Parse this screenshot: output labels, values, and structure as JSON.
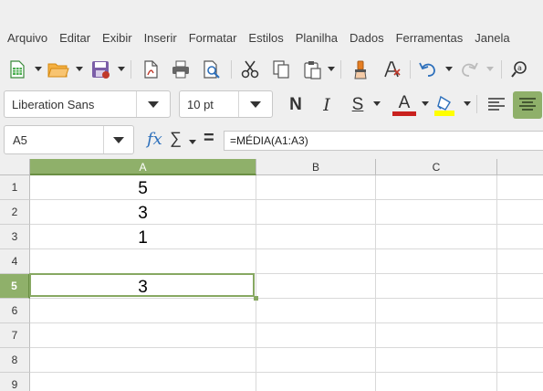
{
  "menubar": {
    "items": [
      "Arquivo",
      "Editar",
      "Exibir",
      "Inserir",
      "Formatar",
      "Estilos",
      "Planilha",
      "Dados",
      "Ferramentas",
      "Janela"
    ]
  },
  "toolbar_icons": [
    "new-spreadsheet-icon",
    "open-icon",
    "save-icon",
    "export-pdf-icon",
    "print-icon",
    "print-preview-icon",
    "cut-icon",
    "copy-icon",
    "paste-icon",
    "clone-formatting-icon",
    "clear-formatting-icon",
    "undo-icon",
    "redo-icon",
    "find-replace-icon"
  ],
  "formatting": {
    "font_name": "Liberation Sans",
    "font_size": "10 pt",
    "bold_label": "N",
    "italic_label": "I",
    "underline_label": "S",
    "font_color_label": "A",
    "font_color": "#c9211e",
    "highlight_color": "#ffff00"
  },
  "formula_bar": {
    "name_box": "A5",
    "function_wizard_label": "fx",
    "sum_label": "∑",
    "equals_label": "=",
    "formula": "=MÉDIA(A1:A3)"
  },
  "sheet": {
    "columns": [
      "A",
      "B",
      "C"
    ],
    "rows": [
      "1",
      "2",
      "3",
      "4",
      "5",
      "6",
      "7",
      "8",
      "9"
    ],
    "active_cell": "A5",
    "cells": {
      "A1": "5",
      "A2": "3",
      "A3": "1",
      "A5": "3"
    }
  },
  "colors": {
    "selection": "#87a862",
    "header_active": "#8fb06a",
    "chrome": "#efefef"
  }
}
